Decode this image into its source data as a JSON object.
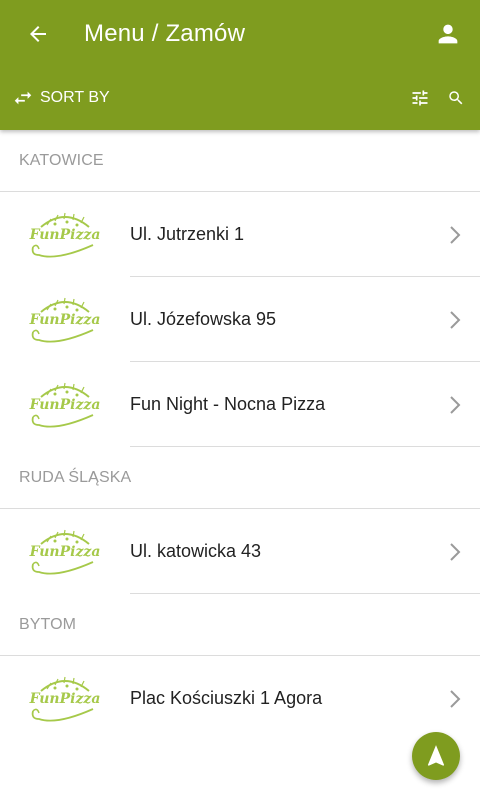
{
  "header": {
    "title": "Menu / Zamów",
    "sort_label": "SORT BY",
    "accent_color": "#7f9c1f"
  },
  "icons": {
    "back": "arrow-left-icon",
    "account": "person-icon",
    "sort": "swap-arrows-icon",
    "filter": "sliders-icon",
    "search": "search-icon",
    "chevron": "chevron-right-icon",
    "fab": "navigation-arrow-icon"
  },
  "brand": {
    "logo_text": "FunPizza"
  },
  "sections": [
    {
      "name": "KATOWICE",
      "items": [
        {
          "label": "Ul. Jutrzenki 1"
        },
        {
          "label": "Ul. Józefowska 95"
        },
        {
          "label": "Fun Night - Nocna Pizza"
        }
      ]
    },
    {
      "name": "RUDA ŚLĄSKA",
      "items": [
        {
          "label": "Ul. katowicka 43"
        }
      ]
    },
    {
      "name": "BYTOM",
      "items": [
        {
          "label": "Plac Kościuszki 1 Agora"
        }
      ]
    }
  ]
}
